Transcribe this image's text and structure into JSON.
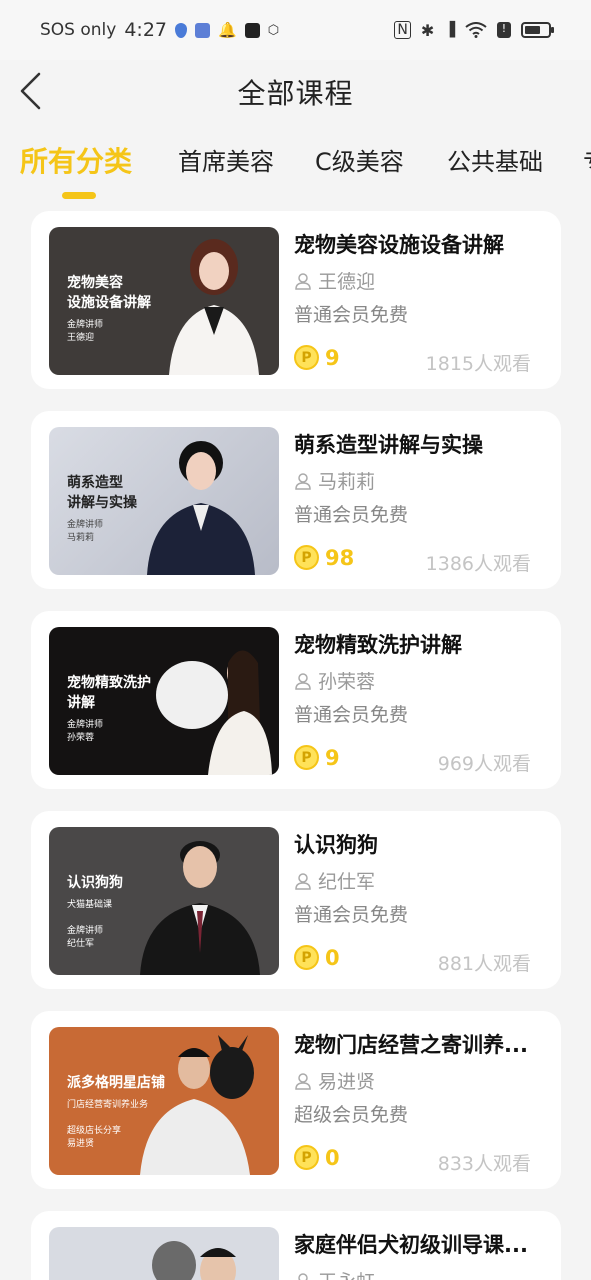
{
  "status_bar": {
    "carrier": "SOS only",
    "time": "4:27"
  },
  "header": {
    "title": "全部课程",
    "back_icon": "chevron-left-icon"
  },
  "tabs": [
    {
      "label": "所有分类",
      "active": true
    },
    {
      "label": "首席美容",
      "active": false
    },
    {
      "label": "C级美容",
      "active": false
    },
    {
      "label": "公共基础",
      "active": false
    },
    {
      "label": "专",
      "active": false
    }
  ],
  "colors": {
    "accent": "#f5c518",
    "background": "#f4f4f4",
    "card": "#ffffff"
  },
  "courses": [
    {
      "title": "宠物美容设施设备讲解",
      "instructor": "王德迎",
      "member_price": "普通会员免费",
      "points": "9",
      "views": "1815人观看",
      "thumb": {
        "title": "宠物美容\n设施设备讲解",
        "subtitle": "金牌讲师\n王德迎",
        "bg": "#3f3b39"
      }
    },
    {
      "title": "萌系造型讲解与实操",
      "instructor": "马莉莉",
      "member_price": "普通会员免费",
      "points": "98",
      "views": "1386人观看",
      "thumb": {
        "title": "萌系造型\n讲解与实操",
        "subtitle": "金牌讲师\n马莉莉",
        "bg": "#c9ccd6"
      }
    },
    {
      "title": "宠物精致洗护讲解",
      "instructor": "孙荣蓉",
      "member_price": "普通会员免费",
      "points": "9",
      "views": "969人观看",
      "thumb": {
        "title": "宠物精致洗护\n讲解",
        "subtitle": "金牌讲师\n孙荣蓉",
        "bg": "#141212"
      }
    },
    {
      "title": "认识狗狗",
      "instructor": "纪仕军",
      "member_price": "普通会员免费",
      "points": "0",
      "views": "881人观看",
      "thumb": {
        "title": "认识狗狗",
        "subtitle": "犬猫基础课\n\n金牌讲师\n纪仕军",
        "bg": "#4a4848"
      }
    },
    {
      "title": "宠物门店经营之寄训养...",
      "instructor": "易进贤",
      "member_price": "超级会员免费",
      "points": "0",
      "views": "833人观看",
      "thumb": {
        "title": "派多格明星店铺",
        "subtitle": "门店经营寄训养业务\n\n超级店长分享\n易进贤",
        "bg": "#c86a35"
      }
    },
    {
      "title": "家庭伴侣犬初级训导课...",
      "instructor": "王永虹",
      "member_price": "",
      "points": "",
      "views": "",
      "thumb": {
        "title": "",
        "subtitle": "",
        "bg": "#d8dbe2"
      }
    }
  ]
}
